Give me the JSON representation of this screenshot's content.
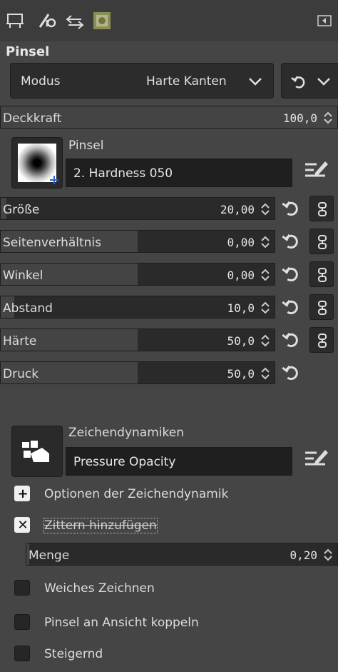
{
  "tabs": [
    {
      "name": "tool-options"
    },
    {
      "name": "device-status"
    },
    {
      "name": "undo-history"
    },
    {
      "name": "images"
    }
  ],
  "title": "Pinsel",
  "mode": {
    "label": "Modus",
    "value": "Harte Kanten"
  },
  "opacity": {
    "label": "Deckkraft",
    "value": "100,0",
    "fraction": 1.0
  },
  "brush": {
    "section_label": "Pinsel",
    "name": "2. Hardness 050"
  },
  "params": [
    {
      "label": "Größe",
      "value": "20,00",
      "fraction": 0.02
    },
    {
      "label": "Seitenverhältnis",
      "value": "0,00",
      "fraction": 0.5
    },
    {
      "label": "Winkel",
      "value": "0,00",
      "fraction": 0.5
    },
    {
      "label": "Abstand",
      "value": "10,0",
      "fraction": 0.05
    },
    {
      "label": "Härte",
      "value": "50,0",
      "fraction": 0.5
    },
    {
      "label": "Druck",
      "value": "50,0",
      "fraction": 0.5
    }
  ],
  "dynamics": {
    "section_label": "Zeichendynamiken",
    "name": "Pressure Opacity"
  },
  "dynamics_options": {
    "label": "Optionen der Zeichendynamik"
  },
  "jitter": {
    "label": "Zittern hinzufügen",
    "amount_label": "Menge",
    "amount_value": "0,20",
    "amount_fraction": 0.01
  },
  "checks": [
    {
      "label": "Weiches Zeichnen"
    },
    {
      "label": "Pinsel an Ansicht koppeln"
    },
    {
      "label": "Steigernd"
    }
  ],
  "colors": {
    "bg": "#454545",
    "field": "#2a2a2a",
    "fill": "#444444"
  }
}
